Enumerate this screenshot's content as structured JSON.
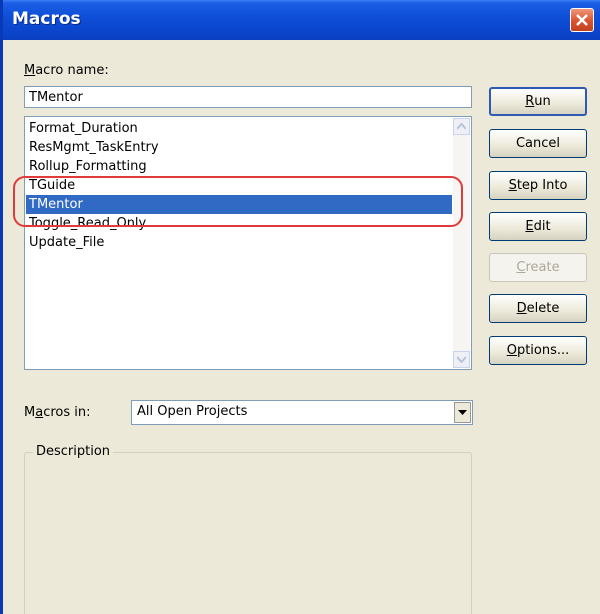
{
  "window": {
    "title": "Macros"
  },
  "macro_name": {
    "label": "Macro name:",
    "accesskey": "M",
    "value": "TMentor"
  },
  "macro_list": {
    "items": [
      {
        "label": "Format_Duration",
        "selected": false
      },
      {
        "label": "ResMgmt_TaskEntry",
        "selected": false
      },
      {
        "label": "Rollup_Formatting",
        "selected": false
      },
      {
        "label": "TGuide",
        "selected": false
      },
      {
        "label": "TMentor",
        "selected": true
      },
      {
        "label": "Toggle_Read_Only",
        "selected": false
      },
      {
        "label": "Update_File",
        "selected": false
      }
    ]
  },
  "buttons": {
    "run": {
      "label": "Run",
      "accesskey": "R"
    },
    "cancel": {
      "label": "Cancel"
    },
    "step_into": {
      "label": "Step Into",
      "accesskey": "S"
    },
    "edit": {
      "label": "Edit",
      "accesskey": "E"
    },
    "create": {
      "label": "Create",
      "accesskey": "C",
      "enabled": false
    },
    "delete": {
      "label": "Delete",
      "accesskey": "D"
    },
    "options": {
      "label": "Options...",
      "accesskey": "O"
    }
  },
  "macros_in": {
    "label": "Macros in:",
    "accesskey": "a",
    "value": "All Open Projects"
  },
  "description": {
    "label": "Description"
  },
  "icons": {
    "close": "close-icon",
    "scroll_up": "chevron-up-icon",
    "scroll_down": "chevron-down-icon",
    "dropdown": "dropdown-arrow-icon"
  },
  "colors": {
    "titlebar": "#0b47cf",
    "selection": "#316ac5",
    "highlight_ring": "#e03a3a",
    "dialog_bg": "#ece9d8"
  }
}
